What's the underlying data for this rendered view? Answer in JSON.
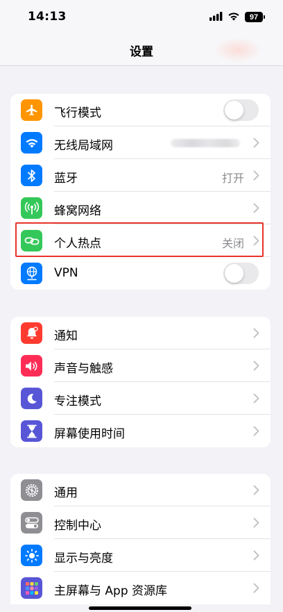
{
  "status_bar": {
    "time": "14:13",
    "battery": "97",
    "icons": [
      "cellular-signal-icon",
      "wifi-icon",
      "battery-icon"
    ]
  },
  "header": {
    "title": "设置"
  },
  "groups": [
    {
      "items": [
        {
          "label": "飞行模式",
          "icon": "airplane-icon",
          "icon_color": "#ff9500",
          "control": "toggle",
          "toggle_on": false
        },
        {
          "label": "无线局域网",
          "icon": "wifi-icon",
          "icon_color": "#007aff",
          "control": "chevron",
          "value_blurred": true
        },
        {
          "label": "蓝牙",
          "icon": "bluetooth-icon",
          "icon_color": "#007aff",
          "control": "chevron",
          "value": "打开"
        },
        {
          "label": "蜂窝网络",
          "icon": "cellular-antenna-icon",
          "icon_color": "#34c759",
          "control": "chevron"
        },
        {
          "label": "个人热点",
          "icon": "hotspot-link-icon",
          "icon_color": "#34c759",
          "control": "chevron",
          "value": "关闭",
          "highlighted": true
        },
        {
          "label": "VPN",
          "icon": "vpn-globe-icon",
          "icon_color": "#007aff",
          "control": "toggle",
          "toggle_on": false
        }
      ]
    },
    {
      "items": [
        {
          "label": "通知",
          "icon": "bell-icon",
          "icon_color": "#ff3b30",
          "control": "chevron"
        },
        {
          "label": "声音与触感",
          "icon": "speaker-icon",
          "icon_color": "#ff2d55",
          "control": "chevron"
        },
        {
          "label": "专注模式",
          "icon": "moon-icon",
          "icon_color": "#5856d6",
          "control": "chevron"
        },
        {
          "label": "屏幕使用时间",
          "icon": "hourglass-icon",
          "icon_color": "#5856d6",
          "control": "chevron"
        }
      ]
    },
    {
      "items": [
        {
          "label": "通用",
          "icon": "gear-icon",
          "icon_color": "#8e8e93",
          "control": "chevron"
        },
        {
          "label": "控制中心",
          "icon": "switches-icon",
          "icon_color": "#8e8e93",
          "control": "chevron"
        },
        {
          "label": "显示与亮度",
          "icon": "sun-icon",
          "icon_color": "#007aff",
          "control": "chevron"
        },
        {
          "label": "主屏幕与 App 资源库",
          "icon": "app-grid-icon",
          "icon_color": "#5856d6",
          "control": "chevron"
        }
      ]
    }
  ]
}
